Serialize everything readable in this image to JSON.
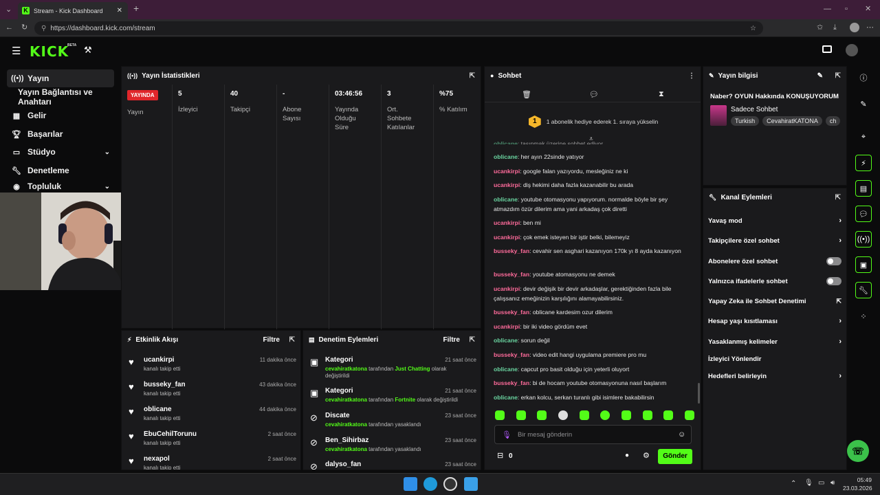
{
  "browser": {
    "tab_title": "Stream - Kick Dashboard",
    "url": "https://dashboard.kick.com/stream"
  },
  "header": {
    "logo": "KICK",
    "beta": "BETA"
  },
  "sidebar": {
    "items": [
      {
        "label": "Yayın"
      },
      {
        "label": "Yayın Bağlantısı ve Anahtarı"
      },
      {
        "label": "Gelir"
      },
      {
        "label": "Başarılar"
      },
      {
        "label": "Stüdyo"
      },
      {
        "label": "Denetleme"
      },
      {
        "label": "Topluluk"
      }
    ]
  },
  "stats": {
    "title": "Yayın İstatistikleri",
    "live_badge": "YAYINDA",
    "columns": [
      {
        "value": "",
        "label": "Yayın"
      },
      {
        "value": "5",
        "label": "İzleyici"
      },
      {
        "value": "40",
        "label": "Takipçi"
      },
      {
        "value": "-",
        "label": "Abone Sayısı"
      },
      {
        "value": "03:46:56",
        "label": "Yayında Olduğu Süre"
      },
      {
        "value": "3",
        "label": "Ort. Sohbete Katılanlar"
      },
      {
        "value": "%75",
        "label": "% Katılım"
      }
    ]
  },
  "activity": {
    "title": "Etkinlik Akışı",
    "filter": "Filtre",
    "events": [
      {
        "name": "ucankirpi",
        "sub": "kanalı takip etti",
        "time": "11 dakika önce"
      },
      {
        "name": "busseky_fan",
        "sub": "kanalı takip etti",
        "time": "43 dakika önce"
      },
      {
        "name": "oblicane",
        "sub": "kanalı takip etti",
        "time": "44 dakika önce"
      },
      {
        "name": "EbuCehilTorunu",
        "sub": "kanalı takip etti",
        "time": "2 saat önce"
      },
      {
        "name": "nexapol",
        "sub": "kanalı takip etti",
        "time": "2 saat önce"
      }
    ]
  },
  "moderation": {
    "title": "Denetim Eylemleri",
    "filter": "Filtre",
    "items": [
      {
        "title": "Kategori",
        "actor": "cevahiratkatona",
        "mid": " tarafından ",
        "target": "Just Chatting",
        "tail": " olarak değiştirildi",
        "time": "21 saat önce"
      },
      {
        "title": "Kategori",
        "actor": "cevahiratkatona",
        "mid": " tarafından ",
        "target": "Fortnite",
        "tail": " olarak değiştirildi",
        "time": "21 saat önce"
      },
      {
        "title": "Discate",
        "actor": "cevahiratkatona",
        "mid": " tarafından yasaklandı",
        "target": "",
        "tail": "",
        "time": "23 saat önce"
      },
      {
        "title": "Ben_Sihirbaz",
        "actor": "cevahiratkatona",
        "mid": " tarafından yasaklandı",
        "target": "",
        "tail": "",
        "time": "23 saat önce"
      },
      {
        "title": "dalyso_fan",
        "actor": "",
        "mid": "",
        "target": "",
        "tail": "",
        "time": "23 saat önce"
      }
    ]
  },
  "chat": {
    "title": "Sohbet",
    "gift_text": "1 abonelik hediye ederek 1. sıraya yükselin",
    "gift_rank": "1",
    "messages": [
      {
        "user": "oblicane",
        "color": "g",
        "text": "her ayın 22sinde yatıyor"
      },
      {
        "user": "ucankirpi",
        "color": "p",
        "text": "google falan yazıyordu, mesleğiniz ne ki"
      },
      {
        "user": "ucankirpi",
        "color": "p",
        "text": "diş hekimi daha fazla kazanabilir bu arada"
      },
      {
        "user": "oblicane",
        "color": "g",
        "text": "youtube otomasyonu yapıyorum. normalde böyle bir şey atmazdım özür dilerim ama yani arkadaş çok diretti"
      },
      {
        "user": "ucankirpi",
        "color": "p",
        "text": "ben mi"
      },
      {
        "user": "ucankirpi",
        "color": "p",
        "text": "çok emek isteyen bir iştir belki, bilemeyiz"
      },
      {
        "user": "busseky_fan",
        "color": "p",
        "text": "cevahir sen asghari kazanıyon 170k yı 8 ayda kazanıyon"
      },
      {
        "user": "busseky_fan",
        "color": "p",
        "text": "youtube atomasyonu ne demek"
      },
      {
        "user": "ucankirpi",
        "color": "p",
        "text": "devir değişik bir devir arkadaşlar, gerektiğinden fazla bile çalışsanız emeğinizin karşılığını alamayabilirsiniz."
      },
      {
        "user": "busseky_fan",
        "color": "p",
        "text": "oblicane kardesim ozur dilerim"
      },
      {
        "user": "ucankirpi",
        "color": "p",
        "text": "bir iki video gördüm evet"
      },
      {
        "user": "oblicane",
        "color": "g",
        "text": "sorun değil"
      },
      {
        "user": "busseky_fan",
        "color": "p",
        "text": "video edit hangi uygulama premiere pro mu"
      },
      {
        "user": "oblicane",
        "color": "g",
        "text": "capcut pro basit olduğu için yeterli oluyort"
      },
      {
        "user": "busseky_fan",
        "color": "p",
        "text": "bi de hocam youtube otomasyonuna nasıl başlarım"
      },
      {
        "user": "oblicane",
        "color": "g",
        "text": "erkan kolcu, serkan turanlı gibi isimlere bakabilirsin"
      }
    ],
    "input_placeholder": "Bir mesaj gönderin",
    "points": "0",
    "send_label": "Gönder"
  },
  "stream_info": {
    "title": "Yayın bilgisi",
    "stream_title": "Naber? OYUN Hakkında KONUŞUYORUM",
    "category": "Sadece Sohbet",
    "tags": [
      "Turkish",
      "CevahiratKATONA",
      "ch"
    ]
  },
  "channel_actions": {
    "title": "Kanal Eylemleri",
    "items": [
      {
        "label": "Yavaş mod",
        "control": "chevron"
      },
      {
        "label": "Takipçilere özel sohbet",
        "control": "chevron"
      },
      {
        "label": "Abonelere özel sohbet",
        "control": "toggle"
      },
      {
        "label": "Yalnızca ifadelerle sohbet",
        "control": "toggle"
      },
      {
        "label": "Yapay Zeka ile Sohbet Denetimi",
        "control": "external"
      },
      {
        "label": "Hesap yaşı kısıtlaması",
        "control": "chevron"
      },
      {
        "label": "Yasaklanmış kelimeler",
        "control": "chevron"
      },
      {
        "label": "İzleyici Yönlendir",
        "control": "none"
      },
      {
        "label": "Hedefleri belirleyin",
        "control": "chevron"
      }
    ]
  },
  "taskbar": {
    "time": "05:49",
    "date": "23.03.2026"
  },
  "colors": {
    "accent": "#53fc18",
    "tab_bar": "#3d1d38",
    "panel": "#1a1a1c",
    "live": "#e0262b",
    "user_pink": "#ff6b9b",
    "user_green": "#6ad4a0"
  }
}
